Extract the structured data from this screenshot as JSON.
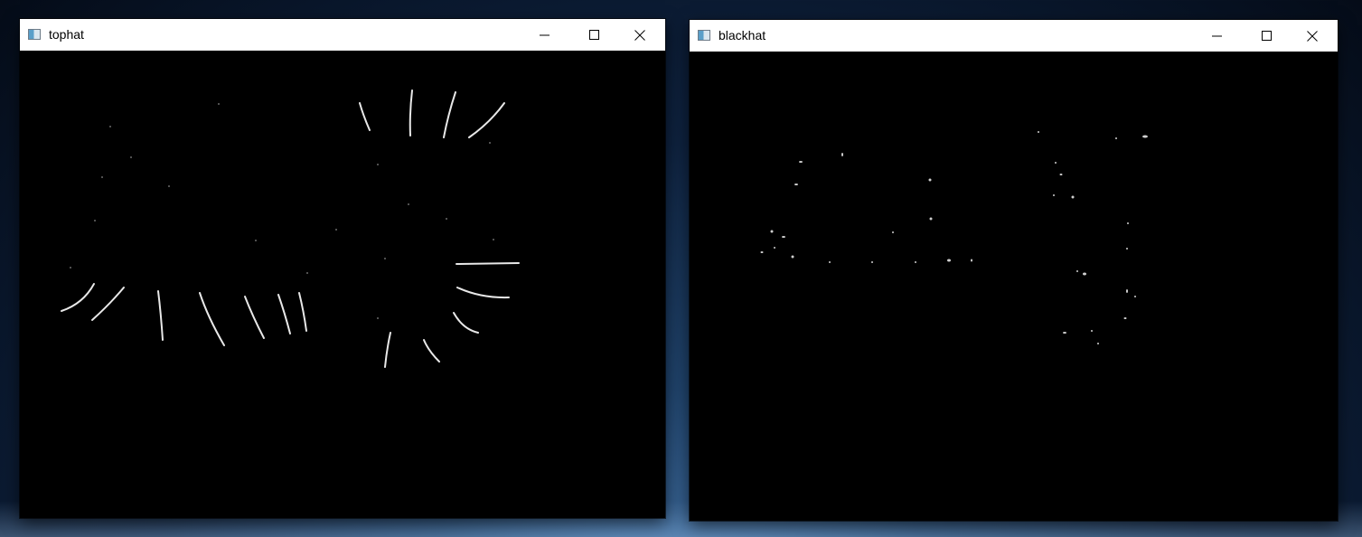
{
  "windows": [
    {
      "title": "tophat",
      "icon": "window-app-icon",
      "controls": [
        "minimize",
        "maximize",
        "close"
      ],
      "content": "tophat-image"
    },
    {
      "title": "blackhat",
      "icon": "window-app-icon",
      "controls": [
        "minimize",
        "maximize",
        "close"
      ],
      "content": "blackhat-image"
    }
  ],
  "colors": {
    "titlebar": "#ffffff",
    "canvas": "#000000",
    "stroke": "#e8e8e8",
    "desktop_top": "#0f2340",
    "desktop_glow": "#4d7fb5"
  }
}
